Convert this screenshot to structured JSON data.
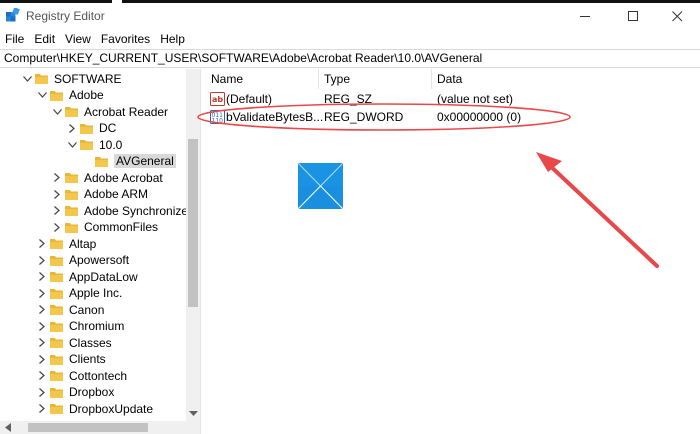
{
  "window": {
    "title": "Registry Editor",
    "controls": {
      "minimize": "—",
      "maximize": "☐",
      "close": "✕"
    }
  },
  "menu": [
    "File",
    "Edit",
    "View",
    "Favorites",
    "Help"
  ],
  "address": "Computer\\HKEY_CURRENT_USER\\SOFTWARE\\Adobe\\Acrobat Reader\\10.0\\AVGeneral",
  "tree": [
    {
      "label": "SOFTWARE",
      "expanded": true
    },
    {
      "label": "Adobe",
      "expanded": true
    },
    {
      "label": "Acrobat Reader",
      "expanded": true
    },
    {
      "label": "DC",
      "expanded": false
    },
    {
      "label": "10.0",
      "expanded": true
    },
    {
      "label": "AVGeneral",
      "selected": true
    },
    {
      "label": "Adobe Acrobat",
      "expanded": false
    },
    {
      "label": "Adobe ARM",
      "expanded": false
    },
    {
      "label": "Adobe Synchronizer",
      "expanded": false
    },
    {
      "label": "CommonFiles",
      "expanded": false
    },
    {
      "label": "Altap",
      "expanded": false
    },
    {
      "label": "Apowersoft",
      "expanded": false
    },
    {
      "label": "AppDataLow",
      "expanded": false
    },
    {
      "label": "Apple Inc.",
      "expanded": false
    },
    {
      "label": "Canon",
      "expanded": false
    },
    {
      "label": "Chromium",
      "expanded": false
    },
    {
      "label": "Classes",
      "expanded": false
    },
    {
      "label": "Clients",
      "expanded": false
    },
    {
      "label": "Cottontech",
      "expanded": false
    },
    {
      "label": "Dropbox",
      "expanded": false
    },
    {
      "label": "DropboxUpdate",
      "expanded": false
    }
  ],
  "list": {
    "columns": [
      "Name",
      "Type",
      "Data"
    ],
    "rows": [
      {
        "name": "(Default)",
        "type": "REG_SZ",
        "data": "(value not set)",
        "icon": "string-value-icon"
      },
      {
        "name": "bValidateBytesB...",
        "type": "REG_DWORD",
        "data": "0x00000000 (0)",
        "icon": "binary-value-icon"
      }
    ]
  },
  "colors": {
    "folder": "#e8b73a",
    "annotation": "#e8484a",
    "selection": "#d9d9d9",
    "windows_logo": "#1a8fe0"
  }
}
